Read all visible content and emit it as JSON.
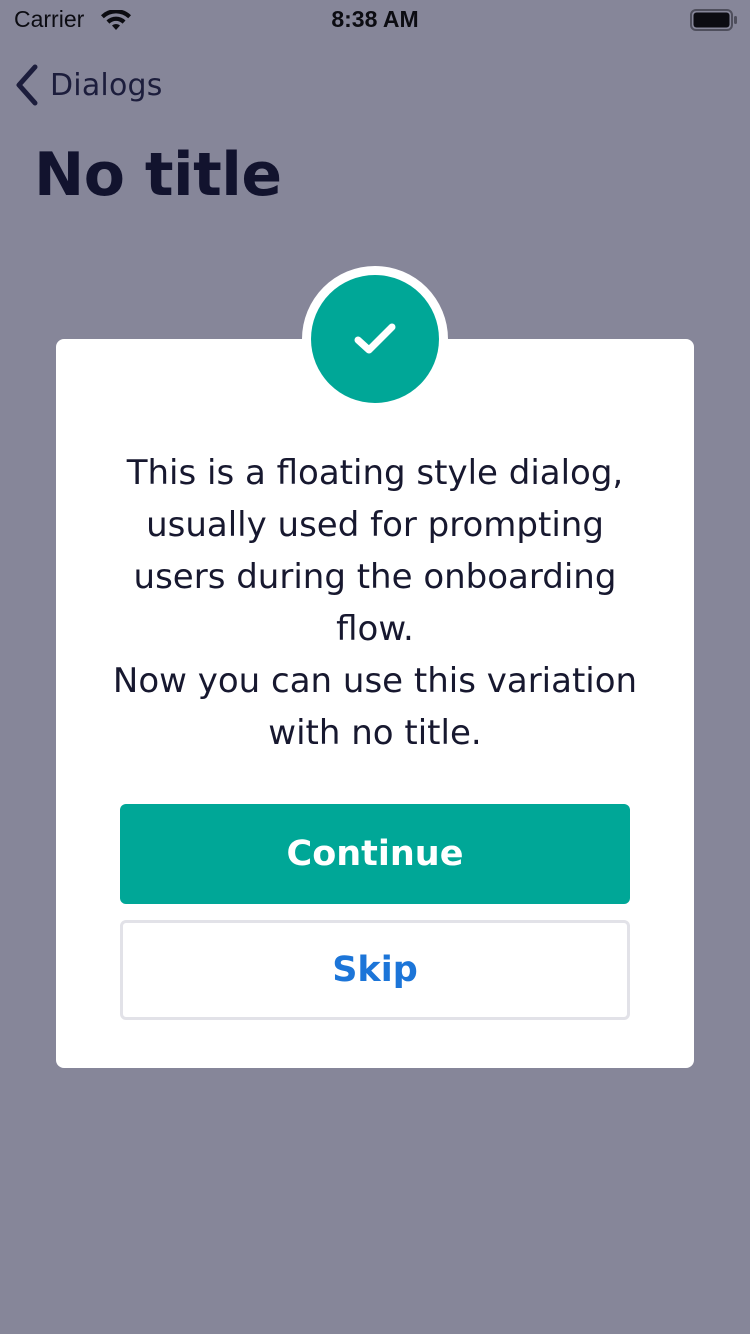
{
  "status_bar": {
    "carrier": "Carrier",
    "time": "8:38 AM",
    "wifi_icon": "wifi-icon",
    "battery_icon": "battery-icon"
  },
  "nav": {
    "back_label": "Dialogs",
    "back_icon": "chevron-left-icon"
  },
  "page": {
    "title": "No title"
  },
  "dialog": {
    "icon": "check-icon",
    "message": "This is a floating style dialog,\nusually used for prompting\nusers during the onboarding\nflow.\nNow you can use this variation\nwith no title.",
    "primary_label": "Continue",
    "secondary_label": "Skip"
  },
  "colors": {
    "overlay_background": "#868699",
    "accent": "#00a797",
    "link": "#1c75d8",
    "text_dark": "#17182f"
  }
}
